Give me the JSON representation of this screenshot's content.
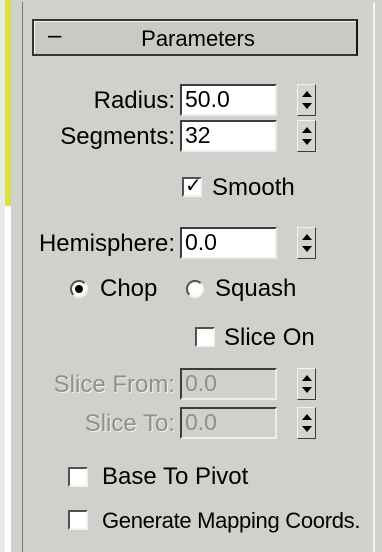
{
  "colors": {
    "panel_bg": "#cfd1cc",
    "field_bg": "#ffffff",
    "disabled_text": "#8e908b",
    "accent_edge": "#dede43"
  },
  "rollout": {
    "collapse_symbol": "–",
    "title": "Parameters"
  },
  "fields": {
    "radius": {
      "label": "Radius:",
      "value": "50.0"
    },
    "segments": {
      "label": "Segments:",
      "value": "32"
    },
    "hemisphere": {
      "label": "Hemisphere:",
      "value": "0.0"
    },
    "slice_from": {
      "label": "Slice From:",
      "value": "0.0"
    },
    "slice_to": {
      "label": "Slice To:",
      "value": "0.0"
    }
  },
  "checkboxes": {
    "smooth": {
      "label": "Smooth",
      "checked": true,
      "mark": "✓"
    },
    "slice_on": {
      "label": "Slice On",
      "checked": false
    },
    "base_to_pivot": {
      "label": "Base To Pivot",
      "checked": false
    },
    "generate_mapping": {
      "label": "Generate Mapping Coords.",
      "checked": false
    }
  },
  "radios": {
    "chop": {
      "label": "Chop",
      "selected": true
    },
    "squash": {
      "label": "Squash",
      "selected": false
    }
  },
  "icons": {
    "spinner": "up-down-arrows-icon"
  }
}
